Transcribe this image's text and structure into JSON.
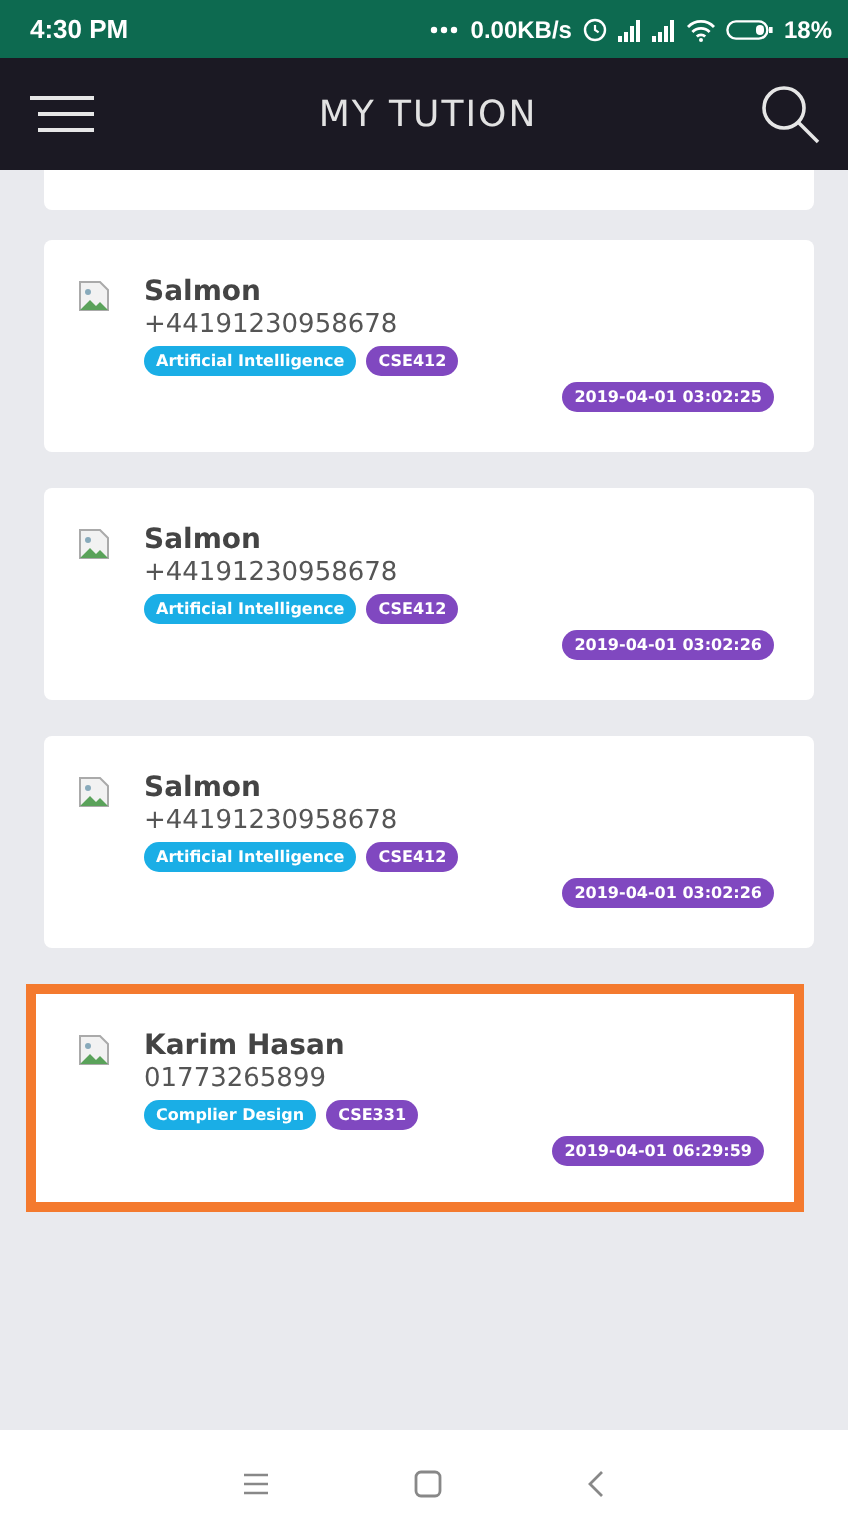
{
  "status_bar": {
    "time": "4:30 PM",
    "network_speed": "0.00KB/s",
    "battery": "18%"
  },
  "app_bar": {
    "title": "MY TUTION"
  },
  "tuitions": [
    {
      "kind": "partial"
    },
    {
      "name": "Salmon",
      "phone": "+44191230958678",
      "subject": "Artificial Intelligence",
      "course": "CSE412",
      "date": "2019-04-01 03:02:25",
      "highlighted": false
    },
    {
      "name": "Salmon",
      "phone": "+44191230958678",
      "subject": "Artificial Intelligence",
      "course": "CSE412",
      "date": "2019-04-01 03:02:26",
      "highlighted": false
    },
    {
      "name": "Salmon",
      "phone": "+44191230958678",
      "subject": "Artificial Intelligence",
      "course": "CSE412",
      "date": "2019-04-01 03:02:26",
      "highlighted": false
    },
    {
      "name": "Karim Hasan",
      "phone": "01773265899",
      "subject": "Complier Design",
      "course": "CSE331",
      "date": "2019-04-01 06:29:59",
      "highlighted": true
    }
  ]
}
